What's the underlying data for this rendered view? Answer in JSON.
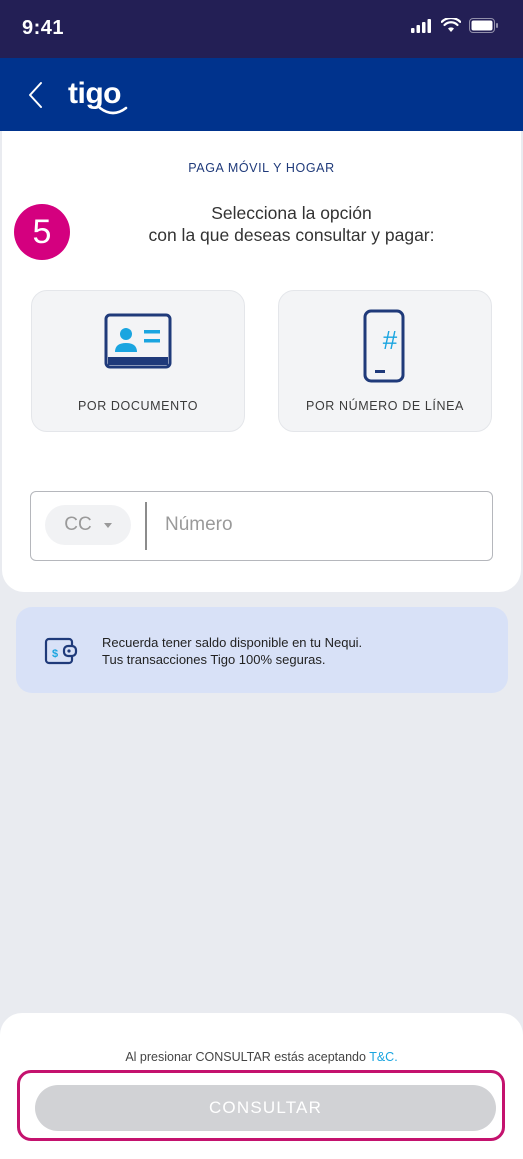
{
  "status_bar": {
    "time": "9:41"
  },
  "header": {
    "logo_text": "tigo"
  },
  "main": {
    "section_title": "PAGA MÓVIL Y HOGAR",
    "step_number": "5",
    "instruction_line1": "Selecciona la opción",
    "instruction_line2": "con la que deseas consultar y pagar:",
    "options": [
      {
        "label": "POR DOCUMENTO",
        "icon": "id-card-icon"
      },
      {
        "label": "POR NÚMERO DE LÍNEA",
        "icon": "phone-hash-icon"
      }
    ],
    "doc_type_selected": "CC",
    "number_placeholder": "Número"
  },
  "info_banner": {
    "line1": "Recuerda tener saldo disponible en tu Nequi.",
    "line2": "Tus transacciones Tigo 100% seguras.",
    "icon": "wallet-icon"
  },
  "footer": {
    "terms_text": "Al presionar CONSULTAR estás aceptando ",
    "terms_link": "T&C.",
    "button_label": "CONSULTAR"
  },
  "colors": {
    "status_bar": "#231f55",
    "header": "#00338d",
    "accent_magenta": "#d4007f",
    "icon_blue": "#1f3a7a",
    "icon_cyan": "#1aa5e0",
    "banner_bg": "#d8e1f7",
    "button_disabled": "#d1d2d5"
  }
}
